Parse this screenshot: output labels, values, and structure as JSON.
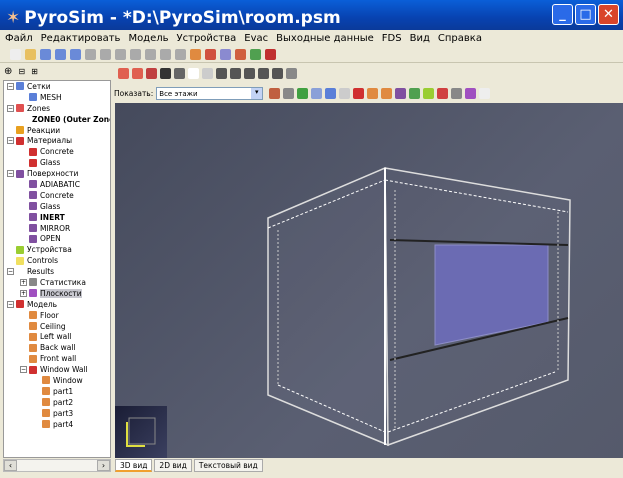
{
  "window": {
    "title": "PyroSim - *D:\\PyroSim\\room.psm",
    "minimize": "_",
    "maximize": "□",
    "close": "✕"
  },
  "menu": [
    "Файл",
    "Редактировать",
    "Модель",
    "Устройства",
    "Evac",
    "Выходные данные",
    "FDS",
    "Вид",
    "Справка"
  ],
  "view_filter": {
    "label": "Показать:",
    "value": "Все этажи"
  },
  "tree": [
    {
      "label": "Сетки",
      "level": 0,
      "exp": "−",
      "color": "#5a7fd8"
    },
    {
      "label": "MESH",
      "level": 1,
      "color": "#5a7fd8"
    },
    {
      "label": "Zones",
      "level": 0,
      "exp": "−",
      "color": "#e05050"
    },
    {
      "label": "ZONE0 (Outer Zone)",
      "level": 1,
      "bold": true,
      "color": "#e05050"
    },
    {
      "label": "Реакции",
      "level": 0,
      "color": "#e8a020"
    },
    {
      "label": "Материалы",
      "level": 0,
      "exp": "−",
      "color": "#d03030"
    },
    {
      "label": "Concrete",
      "level": 1,
      "color": "#d03030"
    },
    {
      "label": "Glass",
      "level": 1,
      "color": "#d03030"
    },
    {
      "label": "Поверхности",
      "level": 0,
      "exp": "−",
      "color": "#8050a0"
    },
    {
      "label": "ADIABATIC",
      "level": 1,
      "color": "#8050a0"
    },
    {
      "label": "Concrete",
      "level": 1,
      "color": "#8050a0"
    },
    {
      "label": "Glass",
      "level": 1,
      "color": "#8050a0"
    },
    {
      "label": "INERT",
      "level": 1,
      "bold": true,
      "color": "#8050a0"
    },
    {
      "label": "MIRROR",
      "level": 1,
      "color": "#8050a0"
    },
    {
      "label": "OPEN",
      "level": 1,
      "color": "#8050a0"
    },
    {
      "label": "Устройства",
      "level": 0,
      "color": "#9acd32"
    },
    {
      "label": "Controls",
      "level": 0,
      "color": "#f0e060"
    },
    {
      "label": "Results",
      "level": 0,
      "exp": "−",
      "color": "#ffffff"
    },
    {
      "label": "Статистика",
      "level": 1,
      "exp": "+",
      "color": "#888888"
    },
    {
      "label": "Плоскости",
      "level": 1,
      "exp": "+",
      "color": "#a050c0",
      "selected": true
    },
    {
      "label": "Модель",
      "level": 0,
      "exp": "−",
      "color": "#d03030"
    },
    {
      "label": "Floor",
      "level": 1,
      "color": "#e08a40"
    },
    {
      "label": "Ceiling",
      "level": 1,
      "color": "#e08a40"
    },
    {
      "label": "Left wall",
      "level": 1,
      "color": "#e08a40"
    },
    {
      "label": "Back wall",
      "level": 1,
      "color": "#e08a40"
    },
    {
      "label": "Front wall",
      "level": 1,
      "color": "#e08a40"
    },
    {
      "label": "Window Wall",
      "level": 1,
      "exp": "−",
      "color": "#d03030"
    },
    {
      "label": "Window",
      "level": 2,
      "color": "#e08a40"
    },
    {
      "label": "part1",
      "level": 2,
      "color": "#e08a40"
    },
    {
      "label": "part2",
      "level": 2,
      "color": "#e08a40"
    },
    {
      "label": "part3",
      "level": 2,
      "color": "#e08a40"
    },
    {
      "label": "part4",
      "level": 2,
      "color": "#e08a40"
    }
  ],
  "view_tabs": [
    "3D вид",
    "2D вид",
    "Текстовый вид"
  ],
  "active_tab": "3D вид"
}
